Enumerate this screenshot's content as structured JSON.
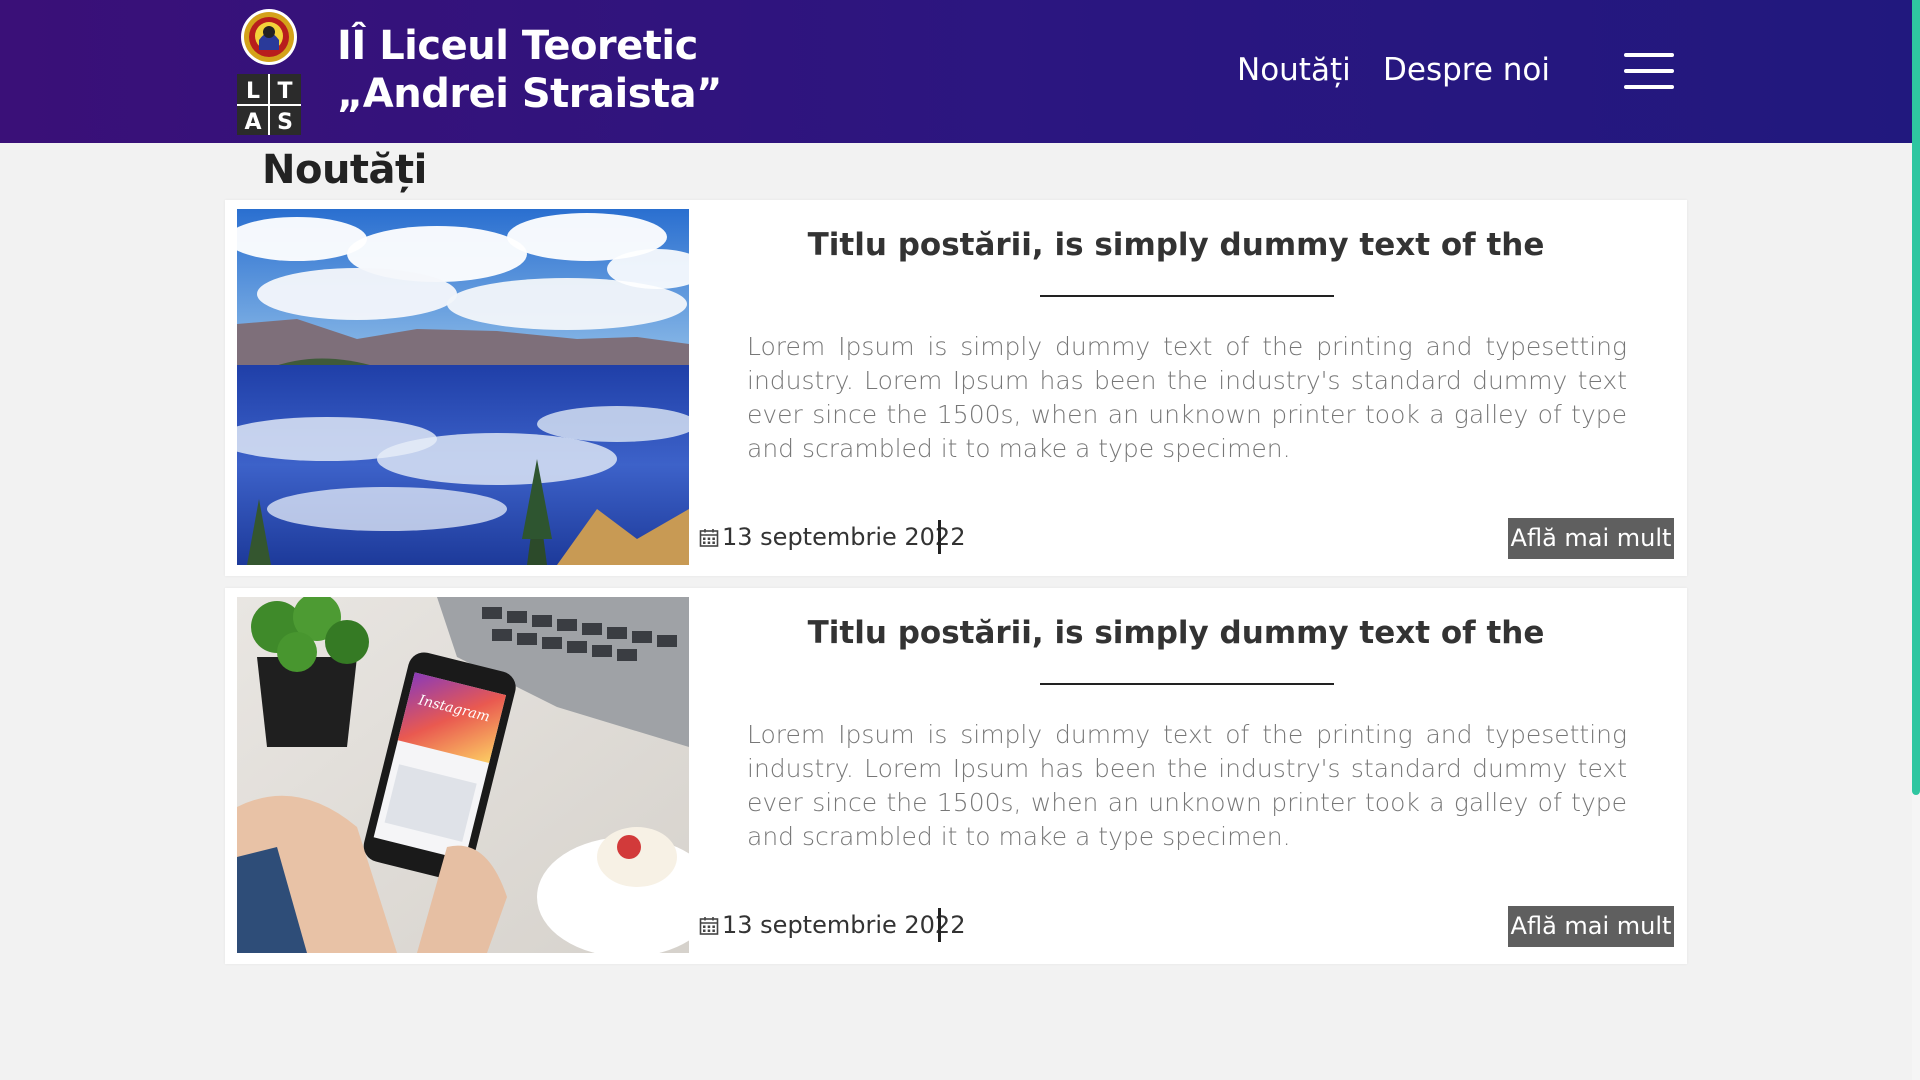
{
  "header": {
    "logo_letters": [
      "L",
      "T",
      "A",
      "S"
    ],
    "school_name_line1": "IÎ Liceul Teoretic",
    "school_name_line2": "„Andrei Straista”",
    "nav": [
      {
        "label": "Noutăți"
      },
      {
        "label": "Despre noi"
      }
    ],
    "menu_icon": "hamburger-menu-icon"
  },
  "section": {
    "title": "Noutăți"
  },
  "posts": [
    {
      "image": "lake-landscape",
      "title": "Titlu postării, is simply dummy text of the",
      "text": "Lorem Ipsum is simply dummy text of the printing and typesetting industry. Lorem Ipsum has been the industry's standard dummy text ever since the 1500s, when an unknown printer took a galley of type and scrambled it to make a type specimen.",
      "date": "13 septembrie 2022",
      "button": "Află mai mult"
    },
    {
      "image": "phone-instagram",
      "image_text": "Instagram",
      "title": "Titlu postării, is simply dummy text of the",
      "text": "Lorem Ipsum is simply dummy text of the printing and typesetting industry. Lorem Ipsum has been the industry's standard dummy text ever since the 1500s, when an unknown printer took a galley of type and scrambled it to make a type specimen.",
      "date": "13 septembrie 2022",
      "button": "Află mai mult"
    }
  ],
  "colors": {
    "header_start": "#3a1078",
    "header_end": "#21187e",
    "button_bg": "#5f5f5f",
    "scrollbar_thumb": "#2fc6a0"
  }
}
